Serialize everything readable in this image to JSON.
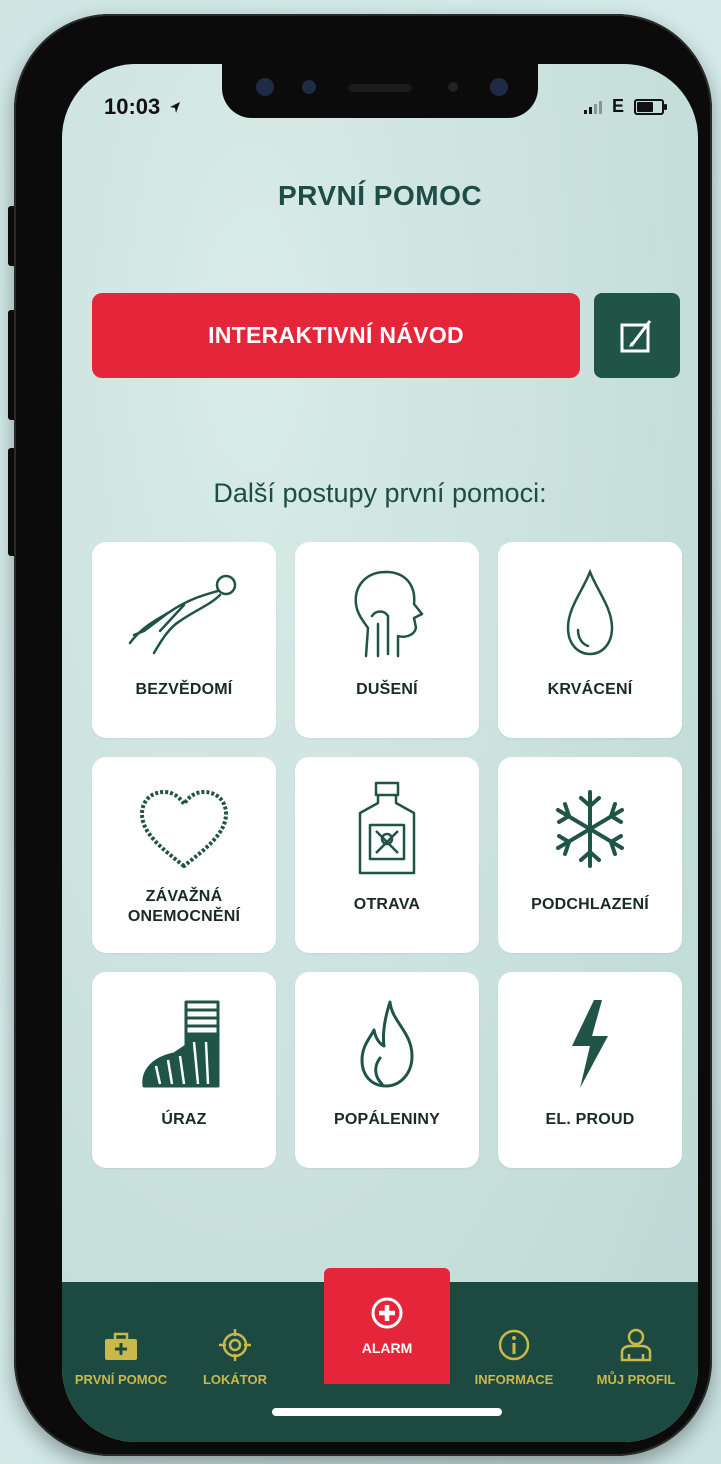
{
  "status_bar": {
    "time": "10:03",
    "network": "E"
  },
  "header": {
    "title": "PRVNÍ POMOC"
  },
  "cta": {
    "label": "INTERAKTIVNÍ NÁVOD"
  },
  "edit_button": {
    "icon": "notepad-pen-icon"
  },
  "section": {
    "subtitle": "Další postupy první pomoci:"
  },
  "tiles": [
    {
      "label": "BEZVĚDOMÍ",
      "icon": "unconscious-person-icon"
    },
    {
      "label": "DUŠENÍ",
      "icon": "choking-head-icon"
    },
    {
      "label": "KRVÁCENÍ",
      "icon": "blood-drop-icon"
    },
    {
      "label_line1": "ZÁVAŽNÁ",
      "label_line2": "ONEMOCNĚNÍ",
      "icon": "heart-icon"
    },
    {
      "label": "OTRAVA",
      "icon": "poison-bottle-icon"
    },
    {
      "label": "PODCHLAZENÍ",
      "icon": "snowflake-icon"
    },
    {
      "label": "ÚRAZ",
      "icon": "bandaged-foot-icon"
    },
    {
      "label": "POPÁLENINY",
      "icon": "flame-icon"
    },
    {
      "label": "EL. PROUD",
      "icon": "lightning-icon"
    }
  ],
  "tabbar": {
    "items": [
      {
        "label": "PRVNÍ POMOC",
        "icon": "first-aid-kit-icon"
      },
      {
        "label": "LOKÁTOR",
        "icon": "locator-target-icon"
      },
      {
        "label": "ALARM",
        "icon": "plus-circle-icon"
      },
      {
        "label": "INFORMACE",
        "icon": "info-icon"
      },
      {
        "label": "MŮJ PROFIL",
        "icon": "user-icon"
      }
    ]
  },
  "colors": {
    "accent_red": "#e5263a",
    "dark_green": "#1f5447",
    "tab_text": "#c9b94a"
  }
}
